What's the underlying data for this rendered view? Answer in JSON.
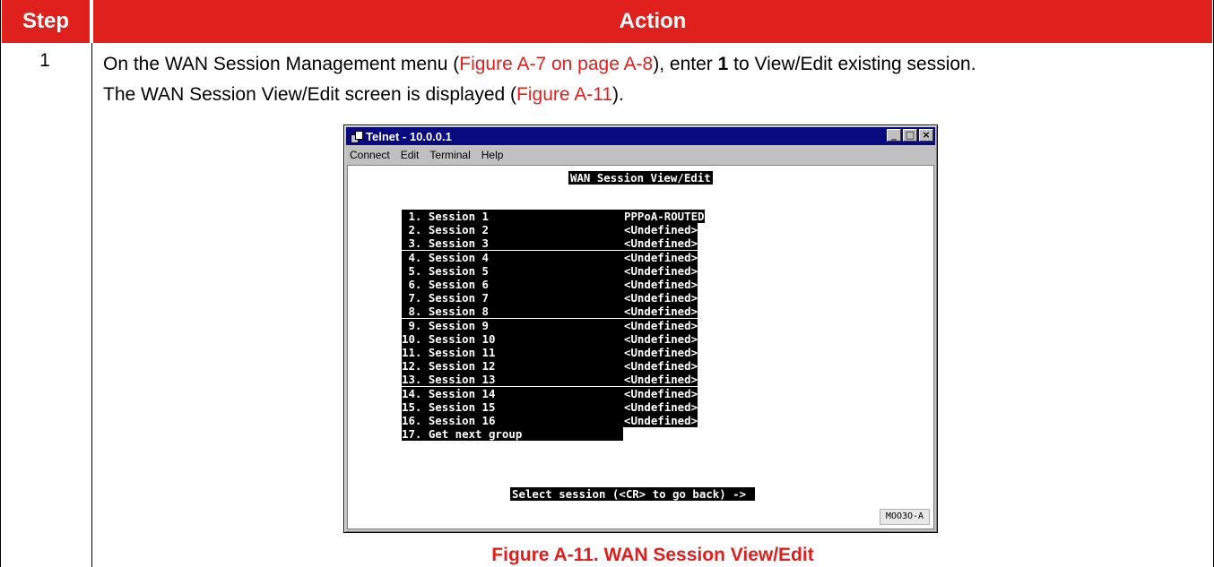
{
  "table": {
    "header_step": "Step",
    "header_action": "Action",
    "colors": {
      "header_bg": "#e0201c",
      "link": "#e0201c"
    }
  },
  "row": {
    "step": "1",
    "text1": "On the WAN Session Management menu (",
    "link1": "Figure A-7 on page A-8",
    "text2": "), enter ",
    "bold1": "1",
    "text3": " to View/Edit existing session.",
    "text4": "The WAN Session View/Edit screen is displayed (",
    "link2": "Figure A-11",
    "text5": ")."
  },
  "telnet": {
    "title": "Telnet - 10.0.0.1",
    "window_buttons": [
      "_",
      "□",
      "×"
    ],
    "menu": [
      "Connect",
      "Edit",
      "Terminal",
      "Help"
    ],
    "screen_title": "WAN Session View/Edit",
    "sessions": [
      {
        "label": " 1. Session 1",
        "value": "PPPoA-ROUTED"
      },
      {
        "label": " 2. Session 2",
        "value": "<Undefined>"
      },
      {
        "label": " 3. Session 3",
        "value": "<Undefined>"
      },
      {
        "label": " 4. Session 4",
        "value": "<Undefined>"
      },
      {
        "label": " 5. Session 5",
        "value": "<Undefined>"
      },
      {
        "label": " 6. Session 6",
        "value": "<Undefined>"
      },
      {
        "label": " 7. Session 7",
        "value": "<Undefined>"
      },
      {
        "label": " 8. Session 8",
        "value": "<Undefined>"
      },
      {
        "label": " 9. Session 9",
        "value": "<Undefined>"
      },
      {
        "label": "10. Session 10",
        "value": "<Undefined>"
      },
      {
        "label": "11. Session 11",
        "value": "<Undefined>"
      },
      {
        "label": "12. Session 12",
        "value": "<Undefined>"
      },
      {
        "label": "13. Session 13",
        "value": "<Undefined>"
      },
      {
        "label": "14. Session 14",
        "value": "<Undefined>"
      },
      {
        "label": "15. Session 15",
        "value": "<Undefined>"
      },
      {
        "label": "16. Session 16",
        "value": "<Undefined>"
      }
    ],
    "get_next": "17. Get next group",
    "prompt": "Select session (<CR> to go back) -> ",
    "figure_code": "MOO3O-A"
  },
  "caption": "Figure A-11. WAN Session View/Edit"
}
